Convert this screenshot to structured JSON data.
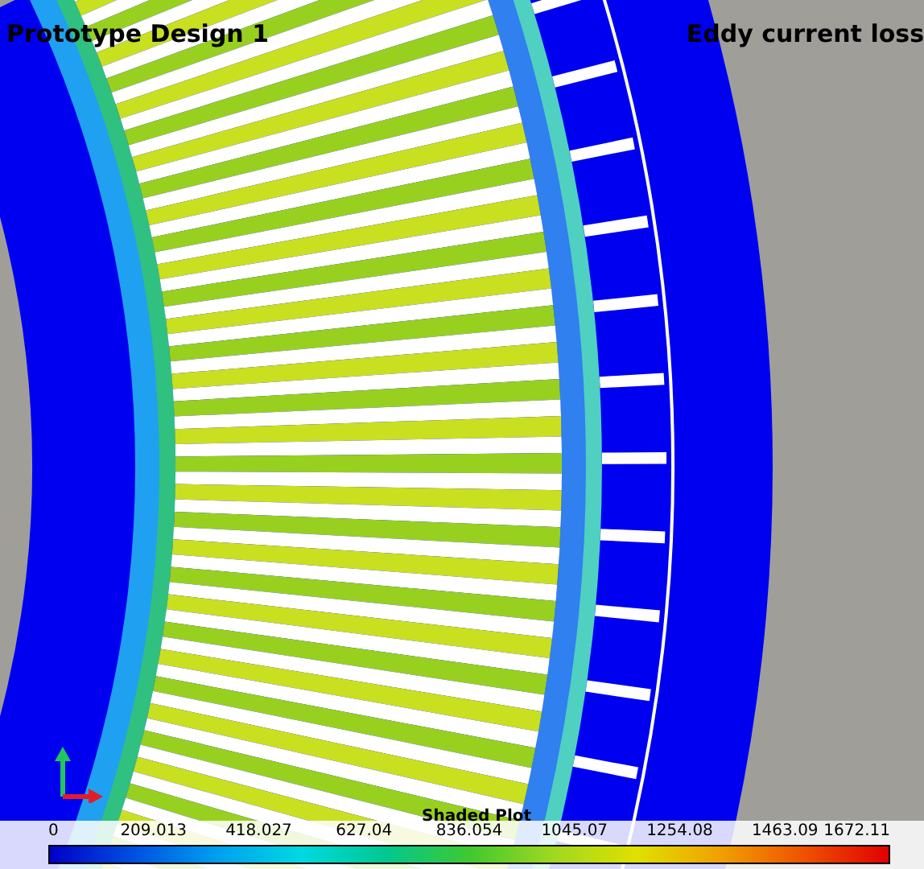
{
  "title": "Prototype Design 1",
  "result_label": "Eddy current loss",
  "legend": {
    "title": "Shaded Plot",
    "ticks": [
      "0",
      "209.013",
      "418.027",
      "627.04",
      "836.054",
      "1045.07",
      "1254.08",
      "1463.09",
      "1672.11"
    ]
  }
}
